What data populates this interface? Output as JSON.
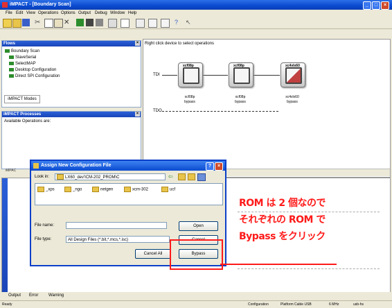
{
  "window": {
    "title": "iMPACT - [Boundary Scan]"
  },
  "menu": [
    "File",
    "Edit",
    "View",
    "Operations",
    "Options",
    "Output",
    "Debug",
    "Window",
    "Help"
  ],
  "flows_panel": {
    "title": "Flows",
    "items": [
      "Boundary Scan",
      "SlaveSerial",
      "SelectMAP",
      "Desktop Configuration",
      "Direct SPI Configuration"
    ],
    "tab": "iMPACT Modes"
  },
  "processes_panel": {
    "title": "iMPACT Processes",
    "text": "Available Operations are:"
  },
  "canvas": {
    "hint": "Right click device to select operations",
    "tdi": "TDI",
    "tdo": "TDO",
    "devices": [
      {
        "chip": "xcf08p",
        "name": "xcf08p",
        "state": "bypass"
      },
      {
        "chip": "xcf08p",
        "name": "xcf08p",
        "state": "bypass"
      },
      {
        "chip": "xc4vlx60",
        "name": "xc4vlx60",
        "state": "bypass"
      }
    ]
  },
  "dialog": {
    "title": "Assign New Configuration File",
    "look_in_label": "Look in:",
    "look_in_value": "LX60_dev'ICM-202_PROM\\C",
    "folders": [
      "_xps",
      "_ngo",
      "netgen",
      "xcm-302",
      "ucf"
    ],
    "file_name_label": "File name:",
    "file_type_label": "File type:",
    "file_type_value": "All Design Files (*.bit,*.mcs,*.isc)",
    "open_label": "Open",
    "cancel_label": "Cancel",
    "cancel_all_label": "Cancel All",
    "bypass_label": "Bypass"
  },
  "annotation": {
    "lines": [
      "ROM は 2 個なので",
      "それぞれの ROM で",
      "Bypass をクリック"
    ],
    "color": "#ff1a1a"
  },
  "bottom_tabs": [
    "Output",
    "Error",
    "Warning"
  ],
  "status": {
    "left": "Ready",
    "right": [
      "Configuration",
      "Platform Cable USB",
      "6 MHz",
      "usb-hs"
    ]
  }
}
